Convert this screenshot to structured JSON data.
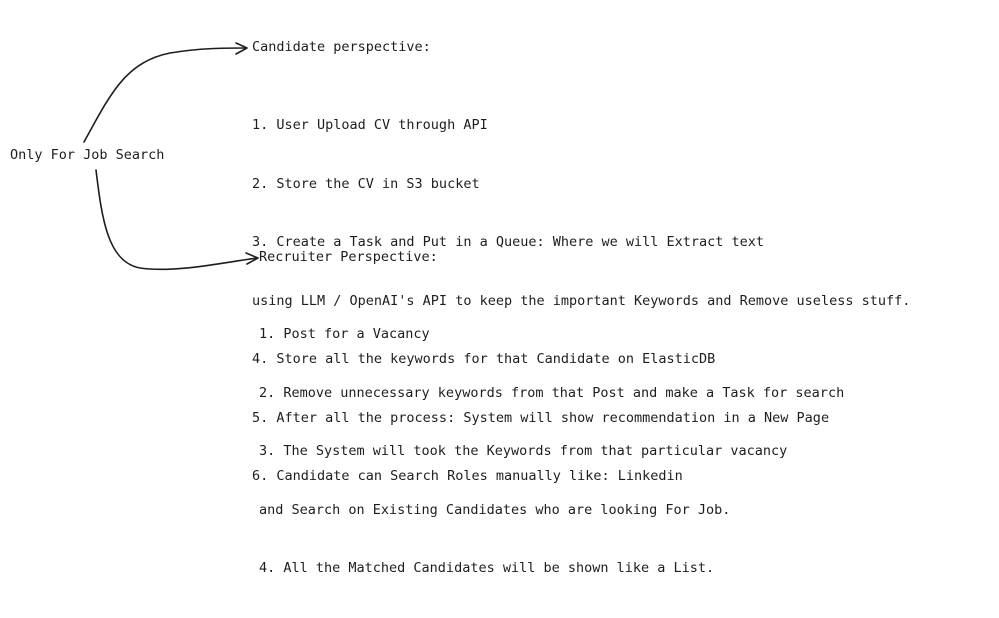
{
  "root": {
    "label": "Only For Job Search"
  },
  "candidate": {
    "heading": "Candidate perspective:",
    "lines": [
      "1. User Upload CV through API",
      "2. Store the CV in S3 bucket",
      "3. Create a Task and Put in a Queue: Where we will Extract text",
      "using LLM / OpenAI's API to keep the important Keywords and Remove useless stuff.",
      "4. Store all the keywords for that Candidate on ElasticDB",
      "5. After all the process: System will show recommendation in a New Page",
      "6. Candidate can Search Roles manually like: Linkedin"
    ]
  },
  "recruiter": {
    "heading": "Recruiter Perspective:",
    "lines": [
      "1. Post for a Vacancy",
      "2. Remove unnecessary keywords from that Post and make a Task for search",
      "3. The System will took the Keywords from that particular vacancy",
      "and Search on Existing Candidates who are looking For Job.",
      "4. All the Matched Candidates will be shown like a List."
    ]
  }
}
